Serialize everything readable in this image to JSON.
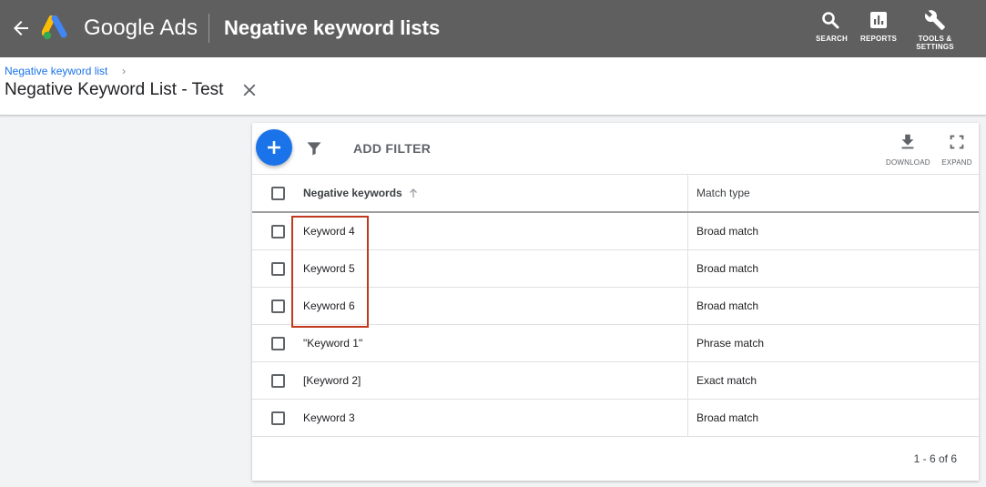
{
  "header": {
    "brand": "Google Ads",
    "page_title": "Negative keyword lists",
    "tools": [
      {
        "label": "SEARCH",
        "icon": "search-icon"
      },
      {
        "label": "REPORTS",
        "icon": "reports-icon"
      },
      {
        "label": "TOOLS &",
        "label2": "SETTINGS",
        "icon": "wrench-icon"
      }
    ]
  },
  "subheader": {
    "breadcrumb": "Negative keyword list",
    "breadcrumb_sep": "›",
    "title": "Negative Keyword List - Test"
  },
  "toolbar": {
    "add_filter": "ADD FILTER",
    "download": "DOWNLOAD",
    "expand": "EXPAND"
  },
  "table": {
    "columns": [
      "Negative keywords",
      "Match type"
    ],
    "rows": [
      {
        "keyword": "Keyword 4",
        "match": "Broad match"
      },
      {
        "keyword": "Keyword 5",
        "match": "Broad match"
      },
      {
        "keyword": "Keyword 6",
        "match": "Broad match"
      },
      {
        "keyword": "\"Keyword 1\"",
        "match": "Phrase match"
      },
      {
        "keyword": "[Keyword 2]",
        "match": "Exact match"
      },
      {
        "keyword": "Keyword 3",
        "match": "Broad match"
      }
    ],
    "pagination": "1 - 6 of 6"
  },
  "colors": {
    "topbar": "#5f5f5f",
    "accent": "#1a73e8",
    "highlight": "#c0391e"
  }
}
